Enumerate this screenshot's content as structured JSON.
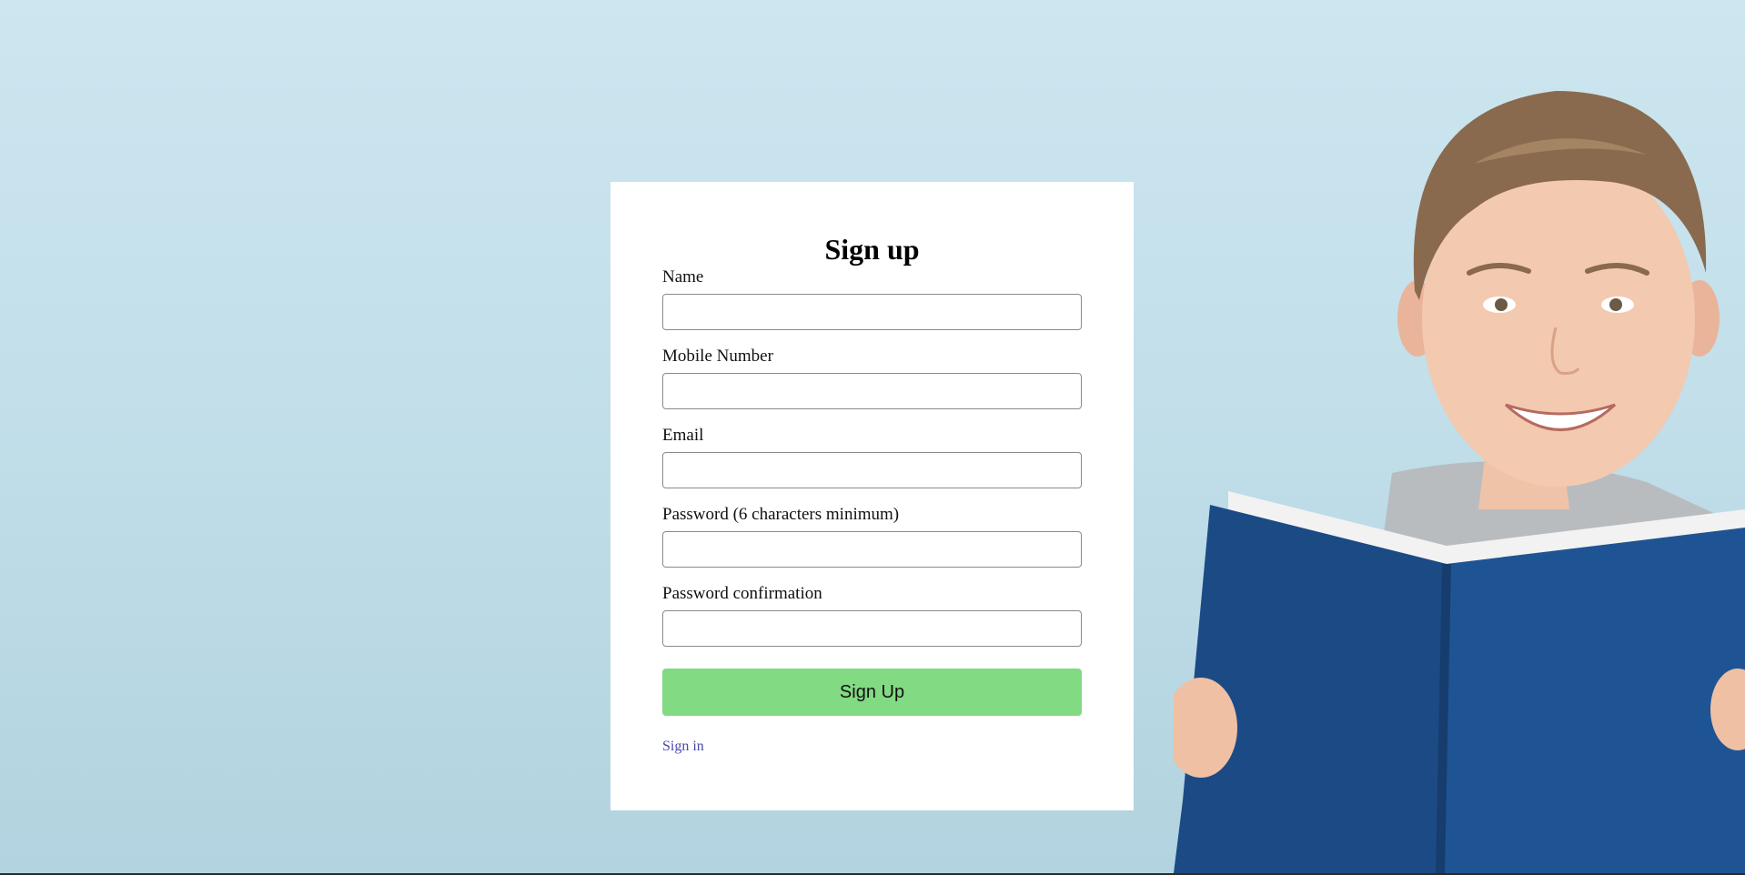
{
  "form": {
    "title": "Sign up",
    "fields": [
      {
        "label": "Name",
        "value": "",
        "placeholder": ""
      },
      {
        "label": "Mobile Number",
        "value": "",
        "placeholder": ""
      },
      {
        "label": "Email",
        "value": "",
        "placeholder": ""
      },
      {
        "label": "Password (6 characters minimum)",
        "value": "",
        "placeholder": ""
      },
      {
        "label": "Password confirmation",
        "value": "",
        "placeholder": ""
      }
    ],
    "submit_label": "Sign Up",
    "signin_link_label": "Sign in"
  },
  "colors": {
    "background": "#c6e2ec",
    "card": "#ffffff",
    "submit_button": "#82da82",
    "link": "#4a4ab0",
    "book_cover": "#1d4f8a"
  },
  "images": {
    "hero": "child-reading-blue-book-photo"
  }
}
